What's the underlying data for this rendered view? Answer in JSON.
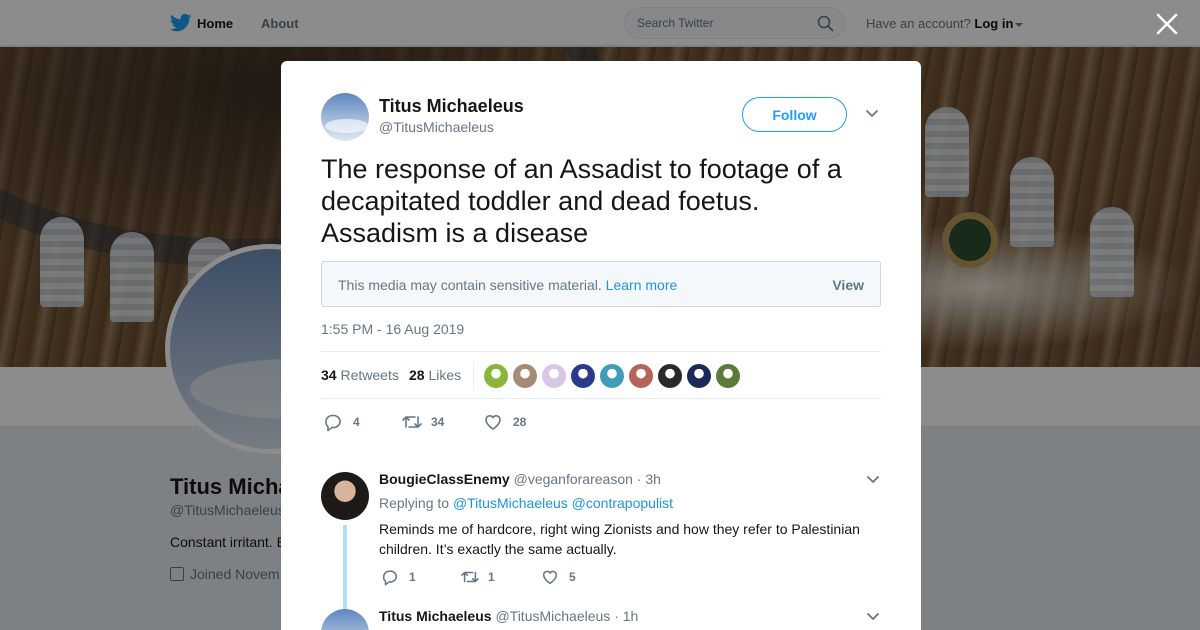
{
  "topbar": {
    "home_label": "Home",
    "about_label": "About",
    "search_placeholder": "Search Twitter",
    "account_prompt": "Have an account?",
    "login_label": "Log in"
  },
  "profile": {
    "name": "Titus Micha",
    "handle": "@TitusMichaeleus",
    "bio": "Constant irritant. E",
    "joined": "Joined Novem"
  },
  "tweet": {
    "author_name": "Titus Michaeleus",
    "author_handle": "@TitusMichaeleus",
    "follow_label": "Follow",
    "text": "The response of an Assadist to footage of a decapitated toddler and dead foetus. Assadism is a disease",
    "sensitive_text": "This media may contain sensitive material.",
    "sensitive_link": "Learn more",
    "sensitive_view": "View",
    "timestamp": "1:55 PM - 16 Aug 2019",
    "retweets_count": "34",
    "retweets_label": "Retweets",
    "likes_count": "28",
    "likes_label": "Likes",
    "likers": [
      "#8ab63a",
      "#a68a77",
      "#d9c7e6",
      "#2b3a8c",
      "#3f9db8",
      "#b4655a",
      "#2a2a2a",
      "#1c2a5a",
      "#5d7a3a"
    ],
    "actions": {
      "replies": "4",
      "retweets": "34",
      "likes": "28"
    }
  },
  "replies": [
    {
      "name": "BougieClassEnemy",
      "handle": "@veganforareason",
      "sep": "·",
      "time": "3h",
      "replying_to_label": "Replying to",
      "mentions": [
        "@TitusMichaeleus",
        "@contrapopulist"
      ],
      "text": "Reminds me of hardcore, right wing Zionists and how they refer to Palestinian children. It’s exactly the same actually.",
      "counts": {
        "replies": "1",
        "retweets": "1",
        "likes": "5"
      }
    },
    {
      "name": "Titus Michaeleus",
      "handle": "@TitusMichaeleus",
      "sep": "·",
      "time": "1h"
    }
  ],
  "colors": {
    "brand": "#1da1f2",
    "link": "#1b95e0",
    "muted": "#657786",
    "thread": "#b2dffc"
  }
}
